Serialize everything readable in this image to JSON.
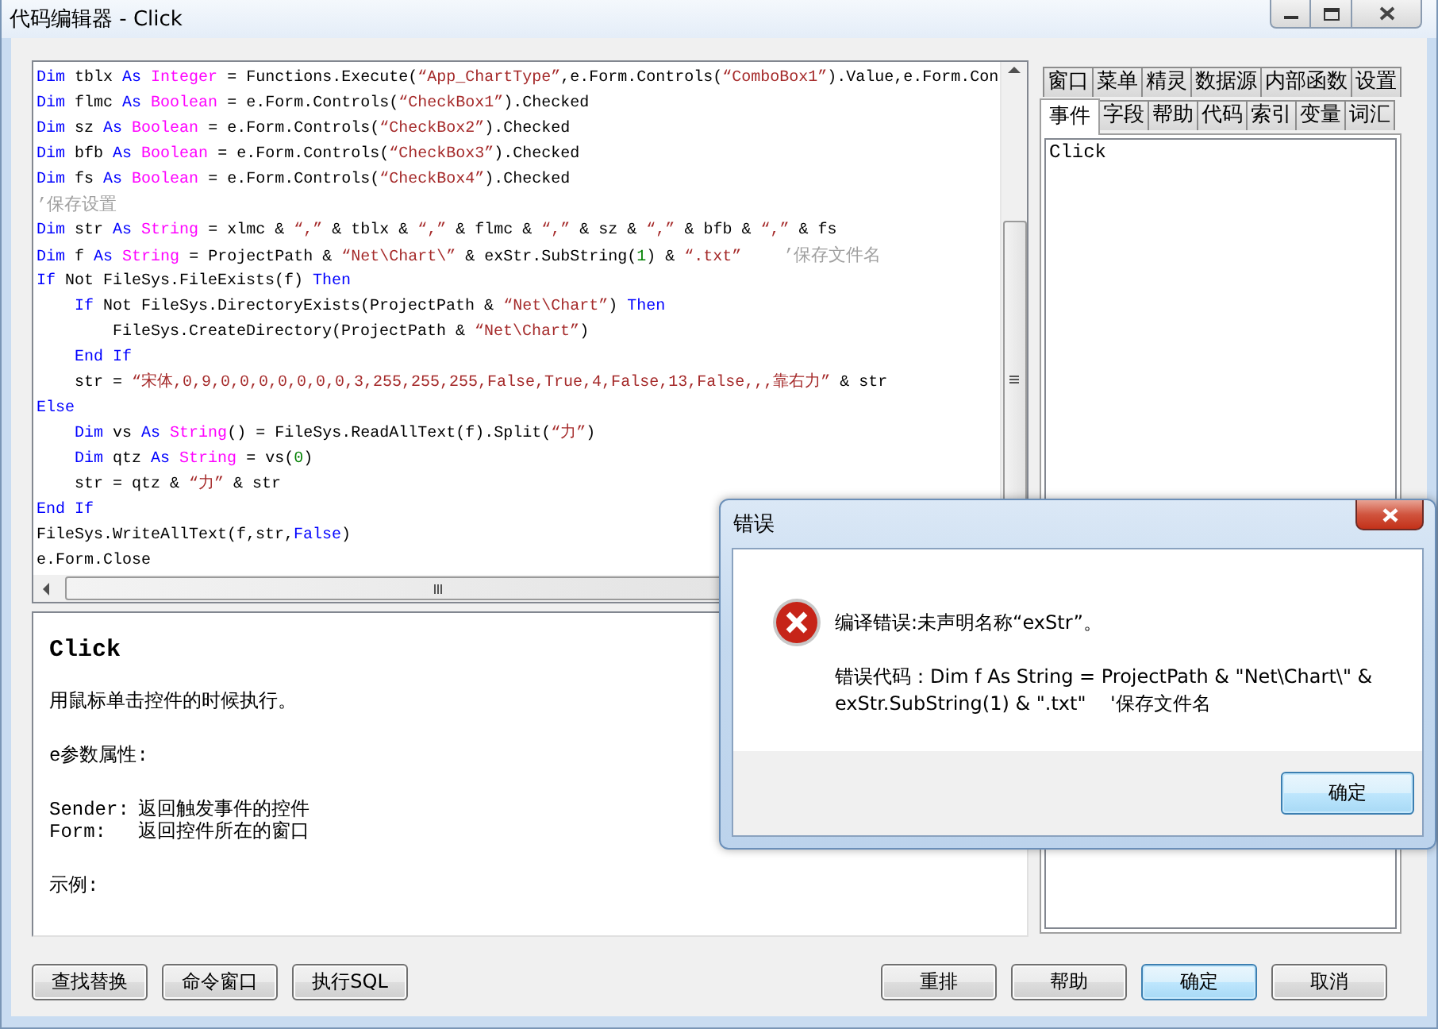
{
  "window": {
    "title": "代码编辑器 - Click"
  },
  "code": {
    "lines": [
      {
        "tokens": [
          {
            "kind": "kw",
            "text": "Dim"
          },
          {
            "kind": "plain",
            "text": " tblx "
          },
          {
            "kind": "kw",
            "text": "As "
          },
          {
            "kind": "type",
            "text": "Integer"
          },
          {
            "kind": "plain",
            "text": " = Functions.Execute("
          },
          {
            "kind": "str",
            "text": "“App_ChartType”"
          },
          {
            "kind": "plain",
            "text": ",e.Form.Controls("
          },
          {
            "kind": "str",
            "text": "“ComboBox1”"
          },
          {
            "kind": "plain",
            "text": ").Value,e.Form.Con"
          }
        ]
      },
      {
        "tokens": [
          {
            "kind": "kw",
            "text": "Dim"
          },
          {
            "kind": "plain",
            "text": " flmc "
          },
          {
            "kind": "kw",
            "text": "As "
          },
          {
            "kind": "type",
            "text": "Boolean"
          },
          {
            "kind": "plain",
            "text": " = e.Form.Controls("
          },
          {
            "kind": "str",
            "text": "“CheckBox1”"
          },
          {
            "kind": "plain",
            "text": ").Checked"
          }
        ]
      },
      {
        "tokens": [
          {
            "kind": "kw",
            "text": "Dim"
          },
          {
            "kind": "plain",
            "text": " sz "
          },
          {
            "kind": "kw",
            "text": "As "
          },
          {
            "kind": "type",
            "text": "Boolean"
          },
          {
            "kind": "plain",
            "text": " = e.Form.Controls("
          },
          {
            "kind": "str",
            "text": "“CheckBox2”"
          },
          {
            "kind": "plain",
            "text": ").Checked"
          }
        ]
      },
      {
        "tokens": [
          {
            "kind": "kw",
            "text": "Dim"
          },
          {
            "kind": "plain",
            "text": " bfb "
          },
          {
            "kind": "kw",
            "text": "As "
          },
          {
            "kind": "type",
            "text": "Boolean"
          },
          {
            "kind": "plain",
            "text": " = e.Form.Controls("
          },
          {
            "kind": "str",
            "text": "“CheckBox3”"
          },
          {
            "kind": "plain",
            "text": ").Checked"
          }
        ]
      },
      {
        "tokens": [
          {
            "kind": "kw",
            "text": "Dim"
          },
          {
            "kind": "plain",
            "text": " fs "
          },
          {
            "kind": "kw",
            "text": "As "
          },
          {
            "kind": "type",
            "text": "Boolean"
          },
          {
            "kind": "plain",
            "text": " = e.Form.Controls("
          },
          {
            "kind": "str",
            "text": "“CheckBox4”"
          },
          {
            "kind": "plain",
            "text": ").Checked"
          }
        ]
      },
      {
        "tokens": [
          {
            "kind": "comment",
            "text": "’保存设置"
          }
        ]
      },
      {
        "tokens": [
          {
            "kind": "kw",
            "text": "Dim"
          },
          {
            "kind": "plain",
            "text": " str "
          },
          {
            "kind": "kw",
            "text": "As "
          },
          {
            "kind": "type",
            "text": "String"
          },
          {
            "kind": "plain",
            "text": " = xlmc & "
          },
          {
            "kind": "str",
            "text": "“,”"
          },
          {
            "kind": "plain",
            "text": " & tblx & "
          },
          {
            "kind": "str",
            "text": "“,”"
          },
          {
            "kind": "plain",
            "text": " & flmc & "
          },
          {
            "kind": "str",
            "text": "“,”"
          },
          {
            "kind": "plain",
            "text": " & sz & "
          },
          {
            "kind": "str",
            "text": "“,”"
          },
          {
            "kind": "plain",
            "text": " & bfb & "
          },
          {
            "kind": "str",
            "text": "“,”"
          },
          {
            "kind": "plain",
            "text": " & fs"
          }
        ]
      },
      {
        "tokens": [
          {
            "kind": "kw",
            "text": "Dim"
          },
          {
            "kind": "plain",
            "text": " f "
          },
          {
            "kind": "kw",
            "text": "As "
          },
          {
            "kind": "type",
            "text": "String"
          },
          {
            "kind": "plain",
            "text": " = ProjectPath & "
          },
          {
            "kind": "str",
            "text": "“Net\\Chart\\”"
          },
          {
            "kind": "plain",
            "text": " & exStr.SubString("
          },
          {
            "kind": "num",
            "text": "1"
          },
          {
            "kind": "plain",
            "text": ") & "
          },
          {
            "kind": "str",
            "text": "“.txt”"
          },
          {
            "kind": "comment",
            "text": "    ’保存文件名"
          }
        ]
      },
      {
        "tokens": [
          {
            "kind": "kw",
            "text": "If"
          },
          {
            "kind": "plain",
            "text": " Not FileSys.FileExists(f) "
          },
          {
            "kind": "kw",
            "text": "Then"
          }
        ]
      },
      {
        "tokens": [
          {
            "kind": "kw",
            "text": "    If"
          },
          {
            "kind": "plain",
            "text": " Not FileSys.DirectoryExists(ProjectPath & "
          },
          {
            "kind": "str",
            "text": "“Net\\Chart”"
          },
          {
            "kind": "plain",
            "text": ") "
          },
          {
            "kind": "kw",
            "text": "Then"
          }
        ]
      },
      {
        "tokens": [
          {
            "kind": "plain",
            "text": "        FileSys.CreateDirectory(ProjectPath & "
          },
          {
            "kind": "str",
            "text": "“Net\\Chart”"
          },
          {
            "kind": "plain",
            "text": ")"
          }
        ]
      },
      {
        "tokens": [
          {
            "kind": "kw",
            "text": "    End If"
          }
        ]
      },
      {
        "tokens": [
          {
            "kind": "plain",
            "text": "    str = "
          },
          {
            "kind": "str",
            "text": "“宋体,0,9,0,0,0,0,0,0,0,3,255,255,255,False,True,4,False,13,False,,,靠右力”"
          },
          {
            "kind": "plain",
            "text": " & str"
          }
        ]
      },
      {
        "tokens": [
          {
            "kind": "kw",
            "text": "Else"
          }
        ]
      },
      {
        "tokens": [
          {
            "kind": "kw",
            "text": "    Dim"
          },
          {
            "kind": "plain",
            "text": " vs "
          },
          {
            "kind": "kw",
            "text": "As "
          },
          {
            "kind": "type",
            "text": "String"
          },
          {
            "kind": "plain",
            "text": "() = FileSys.ReadAllText(f).Split("
          },
          {
            "kind": "str",
            "text": "“力”"
          },
          {
            "kind": "plain",
            "text": ")"
          }
        ]
      },
      {
        "tokens": [
          {
            "kind": "kw",
            "text": "    Dim"
          },
          {
            "kind": "plain",
            "text": " qtz "
          },
          {
            "kind": "kw",
            "text": "As "
          },
          {
            "kind": "type",
            "text": "String"
          },
          {
            "kind": "plain",
            "text": " = vs("
          },
          {
            "kind": "num",
            "text": "0"
          },
          {
            "kind": "plain",
            "text": ")"
          }
        ]
      },
      {
        "tokens": [
          {
            "kind": "plain",
            "text": "    str = qtz & "
          },
          {
            "kind": "str",
            "text": "“力”"
          },
          {
            "kind": "plain",
            "text": " & str"
          }
        ]
      },
      {
        "tokens": [
          {
            "kind": "kw",
            "text": "End If"
          }
        ]
      },
      {
        "tokens": [
          {
            "kind": "plain",
            "text": "FileSys.WriteAllText(f,str,"
          },
          {
            "kind": "kw",
            "text": "False"
          },
          {
            "kind": "plain",
            "text": ")"
          }
        ]
      },
      {
        "tokens": [
          {
            "kind": "plain",
            "text": "e.Form.Close"
          }
        ]
      }
    ]
  },
  "help": {
    "title": "Click",
    "description": "用鼠标单击控件的时候执行。",
    "params_heading": "e参数属性:",
    "params": [
      {
        "name": "Sender:",
        "text": "返回触发事件的控件"
      },
      {
        "name": "Form:",
        "text": "返回控件所在的窗口"
      }
    ],
    "example_heading": "示例:"
  },
  "side_panel": {
    "tab_rows": [
      [
        {
          "label": "窗口",
          "selected": false
        },
        {
          "label": "菜单",
          "selected": false
        },
        {
          "label": "精灵",
          "selected": false
        },
        {
          "label": "数据源",
          "selected": false
        },
        {
          "label": "内部函数",
          "selected": false
        },
        {
          "label": "设置",
          "selected": false
        }
      ],
      [
        {
          "label": "事件",
          "selected": true
        },
        {
          "label": "字段",
          "selected": false
        },
        {
          "label": "帮助",
          "selected": false
        },
        {
          "label": "代码",
          "selected": false
        },
        {
          "label": "索引",
          "selected": false
        },
        {
          "label": "变量",
          "selected": false
        },
        {
          "label": "词汇",
          "selected": false
        }
      ]
    ],
    "items": [
      {
        "label": "Click"
      }
    ]
  },
  "buttons_left": [
    {
      "label": "查找替换",
      "default": false
    },
    {
      "label": "命令窗口",
      "default": false
    },
    {
      "label": "执行SQL",
      "default": false
    }
  ],
  "buttons_right": [
    {
      "label": "重排",
      "default": false
    },
    {
      "label": "帮助",
      "default": false
    },
    {
      "label": "确定",
      "default": true
    },
    {
      "label": "取消",
      "default": false
    }
  ],
  "dialog": {
    "title": "错误",
    "message": "编译错误:未声明名称“exStr”。",
    "detail": "错误代码：Dim f As String = ProjectPath & \"Net\\Chart\\\" & exStr.SubString(1) & \".txt\"    '保存文件名",
    "buttons": [
      {
        "label": "确定",
        "default": true
      }
    ]
  }
}
